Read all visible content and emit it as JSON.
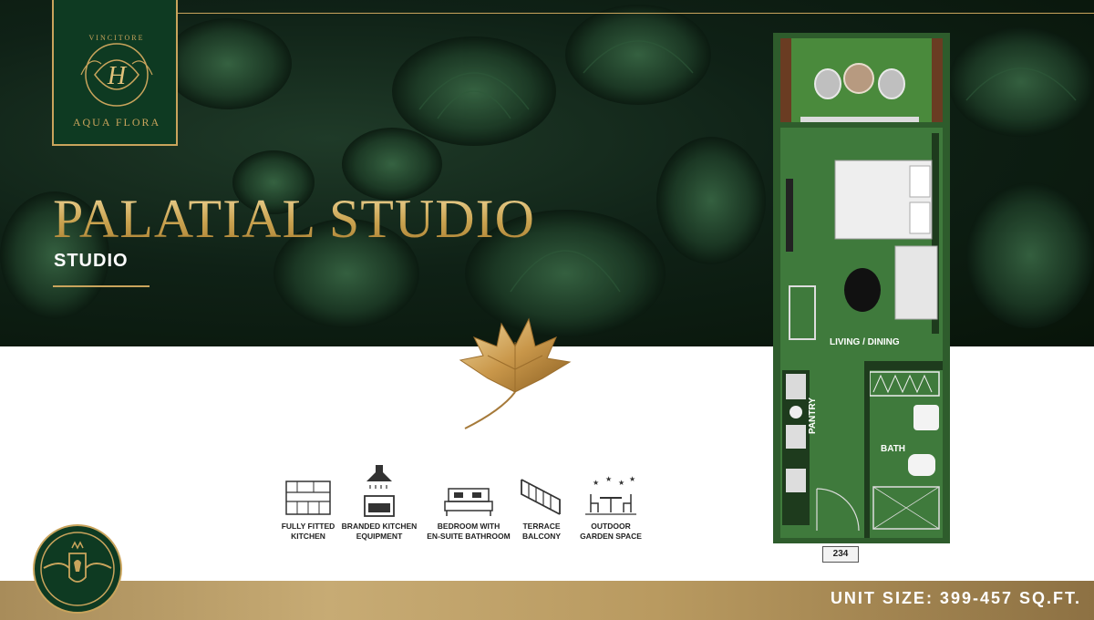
{
  "brand": {
    "logo_text_top": "VINCITORE",
    "logo_text_bottom": "AQUA FLORA"
  },
  "hero": {
    "title": "PALATIAL STUDIO",
    "subtitle": "STUDIO"
  },
  "features": [
    {
      "icon": "kitchen-icon",
      "label_line1": "FULLY FITTED",
      "label_line2": "KITCHEN"
    },
    {
      "icon": "range-hood-icon",
      "label_line1": "BRANDED KITCHEN",
      "label_line2": "EQUIPMENT"
    },
    {
      "icon": "bed-icon",
      "label_line1": "BEDROOM WITH",
      "label_line2": "EN-SUITE BATHROOM"
    },
    {
      "icon": "stairs-railing-icon",
      "label_line1": "TERRACE",
      "label_line2": "BALCONY"
    },
    {
      "icon": "outdoor-table-icon",
      "label_line1": "OUTDOOR",
      "label_line2": "GARDEN SPACE"
    }
  ],
  "floor_plan": {
    "living_label": "LIVING / DINING",
    "pantry_label": "PANTRY",
    "bath_label": "BATH",
    "unit_number": "234"
  },
  "footer": {
    "unit_size": "UNIT SIZE: 399-457 SQ.FT."
  },
  "colors": {
    "hero_green": "#0f2116",
    "brand_green": "#0e3a22",
    "gold": "#c9a45c",
    "plan_green": "#3f7a3c"
  }
}
